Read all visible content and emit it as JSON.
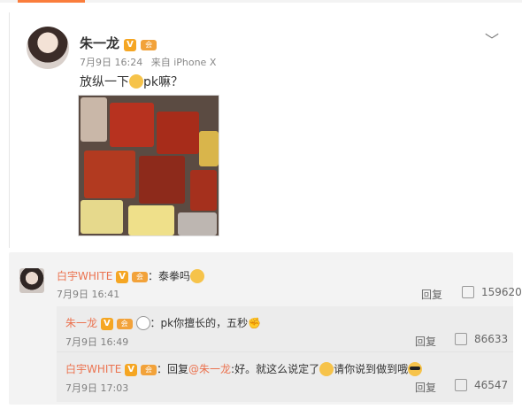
{
  "post": {
    "author": "朱一龙",
    "verified_badge": "V",
    "vip_badge": "会",
    "time": "7月9日 16:24",
    "source": "来自 iPhone X",
    "text_before_emoji": "放纵一下",
    "text_after_emoji": "pk嘛？",
    "more_icon": "﹀"
  },
  "comments": [
    {
      "user": "白宇WHITE",
      "text": "：泰拳吗",
      "time": "7月9日 16:41",
      "reply_label": "回复",
      "likes": "159620",
      "replies": [
        {
          "user": "朱一龙",
          "text": "：pk你擅长的，五秒",
          "time": "7月9日 16:49",
          "reply_label": "回复",
          "likes": "86633"
        },
        {
          "user": "白宇WHITE",
          "text_prefix": "：回复",
          "mention": "@朱一龙",
          "text_mid": ":好。就这么说定了",
          "text_end": "请你说到做到哦",
          "time": "7月9日 17:03",
          "reply_label": "回复",
          "likes": "46547"
        }
      ]
    }
  ],
  "colors": {
    "username": "#eb7350",
    "accent": "#fa7d3c",
    "badge": "#f5a623"
  }
}
